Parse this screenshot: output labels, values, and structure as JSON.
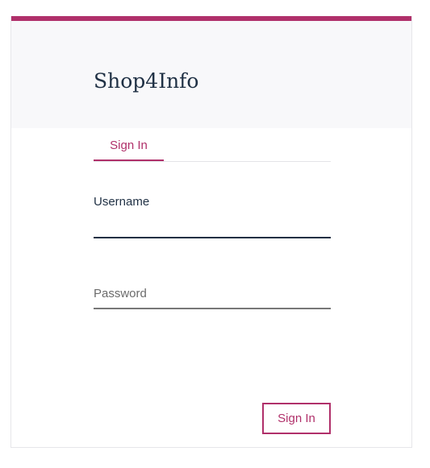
{
  "app": {
    "title": "Shop4Info"
  },
  "tabs": [
    {
      "label": "Sign In",
      "active": true
    }
  ],
  "form": {
    "username": {
      "label": "Username",
      "value": ""
    },
    "password": {
      "label": "Password",
      "value": ""
    },
    "submit_label": "Sign In"
  },
  "colors": {
    "accent": "#b0306a",
    "title_text": "#1f3044",
    "header_background": "#f8f8fa"
  }
}
